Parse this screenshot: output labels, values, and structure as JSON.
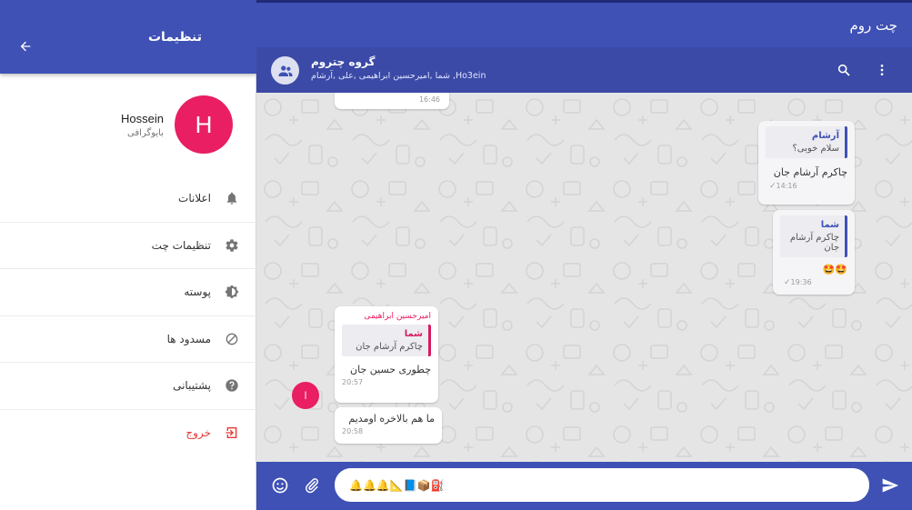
{
  "settings": {
    "title": "تنظیمات",
    "profile": {
      "name": "Hossein",
      "bio": "بایوگرافی",
      "initial": "H"
    },
    "menu": [
      {
        "label": "اعلانات",
        "icon": "bell-icon"
      },
      {
        "label": "تنظیمات چت",
        "icon": "gear-icon"
      },
      {
        "label": "پوسته",
        "icon": "brightness-icon"
      },
      {
        "label": "مسدود ها",
        "icon": "block-icon"
      },
      {
        "label": "پشتیبانی",
        "icon": "help-icon"
      },
      {
        "label": "خروج",
        "icon": "logout-icon"
      }
    ]
  },
  "topbar": {
    "title": "چت روم"
  },
  "chat_header": {
    "group_name": "گروه چتروم",
    "members": "شما ,امیرحسین ابراهیمی ,علی ,آرشام ,Ho3ein"
  },
  "messages": {
    "m0": {
      "time": "16:46"
    },
    "m1": {
      "quote_name": "آرشام",
      "quote_text": "سلام خوبی؟",
      "text": "چاکرم آرشام جان",
      "time": "14:16"
    },
    "m2": {
      "quote_name": "شما",
      "quote_text": "چاکرم آرشام جان",
      "text": "🤩🤩",
      "time": "19:36"
    },
    "m3": {
      "sender": "امیرحسین ابراهیمی",
      "quote_name": "شما",
      "quote_text": "چاکرم آرشام جان",
      "text": "چطوری حسین جان",
      "time": "20:57"
    },
    "m4": {
      "text": "ما هم بالاخره اومدیم",
      "time": "20:58"
    },
    "sender_avatar_initial": "ا"
  },
  "composer": {
    "value": "🔔🔔🔔📐📘📦⛽"
  },
  "colors": {
    "primary": "#3f51b5",
    "accent": "#e91e63",
    "chat_bg": "#e5e5e5"
  }
}
